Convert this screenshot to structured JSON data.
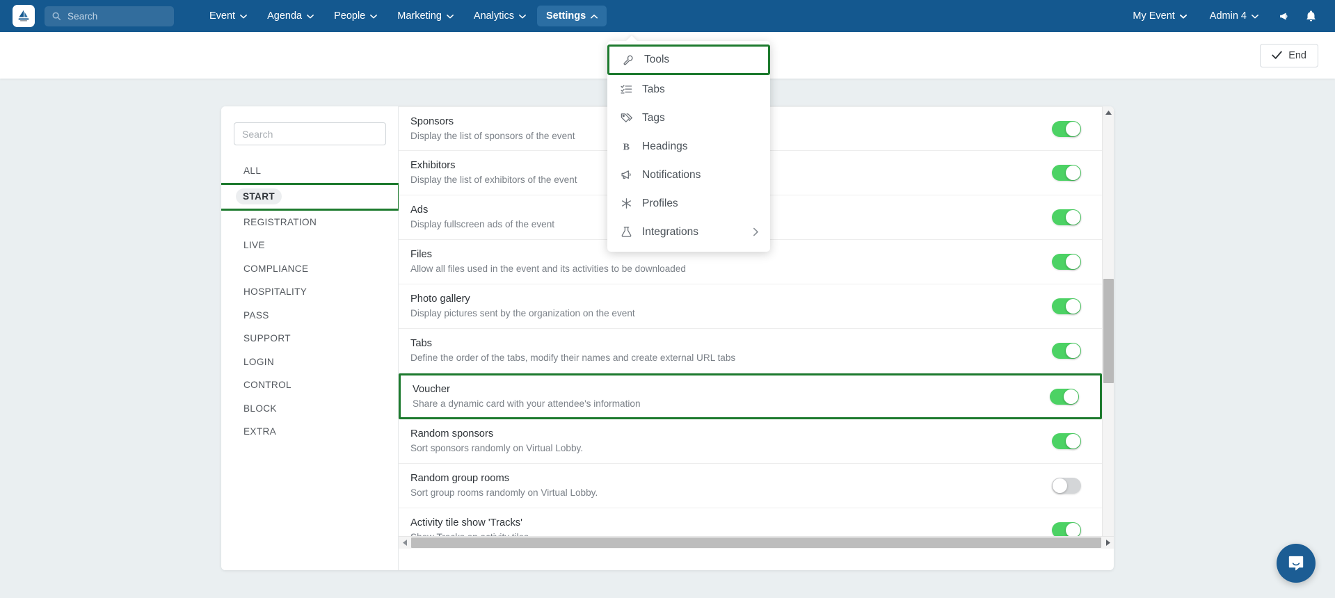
{
  "navbar": {
    "logo_icon": "sailboat-logo-icon",
    "search_placeholder": "Search",
    "search_icon": "search-icon",
    "menus": [
      {
        "label": "Event",
        "icon": "chevron-down-icon"
      },
      {
        "label": "Agenda",
        "icon": "chevron-down-icon"
      },
      {
        "label": "People",
        "icon": "chevron-down-icon"
      },
      {
        "label": "Marketing",
        "icon": "chevron-down-icon"
      },
      {
        "label": "Analytics",
        "icon": "chevron-down-icon"
      },
      {
        "label": "Settings",
        "icon": "chevron-up-icon"
      }
    ],
    "right": {
      "event_label": "My Event",
      "admin_label": "Admin 4",
      "announce_icon": "megaphone-icon",
      "bell_icon": "bell-icon"
    }
  },
  "subheader": {
    "end_label": "End",
    "end_icon": "check-icon"
  },
  "dropdown": {
    "items": [
      {
        "label": "Tools",
        "icon": "wrench-icon",
        "highlighted": true,
        "submenu": false
      },
      {
        "label": "Tabs",
        "icon": "list-checks-icon",
        "highlighted": false,
        "submenu": false
      },
      {
        "label": "Tags",
        "icon": "tags-icon",
        "highlighted": false,
        "submenu": false
      },
      {
        "label": "Headings",
        "icon": "bold-b-icon",
        "highlighted": false,
        "submenu": false
      },
      {
        "label": "Notifications",
        "icon": "megaphone-icon",
        "highlighted": false,
        "submenu": false
      },
      {
        "label": "Profiles",
        "icon": "asterisk-icon",
        "highlighted": false,
        "submenu": false
      },
      {
        "label": "Integrations",
        "icon": "flask-icon",
        "highlighted": false,
        "submenu": true
      }
    ]
  },
  "sidebar": {
    "search_placeholder": "Search",
    "search_value": "",
    "items": [
      {
        "label": "ALL",
        "selected": false,
        "highlighted": false
      },
      {
        "label": "START",
        "selected": true,
        "highlighted": true
      },
      {
        "label": "REGISTRATION",
        "selected": false,
        "highlighted": false
      },
      {
        "label": "LIVE",
        "selected": false,
        "highlighted": false
      },
      {
        "label": "COMPLIANCE",
        "selected": false,
        "highlighted": false
      },
      {
        "label": "HOSPITALITY",
        "selected": false,
        "highlighted": false
      },
      {
        "label": "PASS",
        "selected": false,
        "highlighted": false
      },
      {
        "label": "SUPPORT",
        "selected": false,
        "highlighted": false
      },
      {
        "label": "LOGIN",
        "selected": false,
        "highlighted": false
      },
      {
        "label": "CONTROL",
        "selected": false,
        "highlighted": false
      },
      {
        "label": "BLOCK",
        "selected": false,
        "highlighted": false
      },
      {
        "label": "EXTRA",
        "selected": false,
        "highlighted": false
      }
    ]
  },
  "settings_rows": [
    {
      "title": "Sponsors",
      "description": "Display the list of sponsors of the event",
      "toggle": "on",
      "highlighted": false
    },
    {
      "title": "Exhibitors",
      "description": "Display the list of exhibitors of the event",
      "toggle": "on",
      "highlighted": false
    },
    {
      "title": "Ads",
      "description": "Display fullscreen ads of the event",
      "toggle": "on",
      "highlighted": false
    },
    {
      "title": "Files",
      "description": "Allow all files used in the event and its activities to be downloaded",
      "toggle": "on",
      "highlighted": false
    },
    {
      "title": "Photo gallery",
      "description": "Display pictures sent by the organization on the event",
      "toggle": "on",
      "highlighted": false
    },
    {
      "title": "Tabs",
      "description": "Define the order of the tabs, modify their names and create external URL tabs",
      "toggle": "on",
      "highlighted": false
    },
    {
      "title": "Voucher",
      "description": "Share a dynamic card with your attendee's information",
      "toggle": "on",
      "highlighted": true
    },
    {
      "title": "Random sponsors",
      "description": "Sort sponsors randomly on Virtual Lobby.",
      "toggle": "on",
      "highlighted": false
    },
    {
      "title": "Random group rooms",
      "description": "Sort group rooms randomly on Virtual Lobby.",
      "toggle": "off",
      "highlighted": false
    },
    {
      "title": "Activity tile show 'Tracks'",
      "description": "Show Tracks on activity tiles.",
      "toggle": "on",
      "highlighted": false
    }
  ],
  "scrollbars": {
    "vertical_up_icon": "triangle-up-icon",
    "vertical_down_icon": "triangle-down-icon",
    "horizontal_left_icon": "triangle-left-icon",
    "horizontal_right_icon": "triangle-right-icon"
  },
  "intercom": {
    "icon": "chat-bubble-icon"
  },
  "colors": {
    "navbar_blue": "#14588f",
    "navbar_active_blue": "#2b6ea3",
    "highlight_green": "#1d7a2e",
    "toggle_on_green": "#4cd264",
    "toggle_off_grey": "#d4d6d8",
    "page_background": "#eaeff1",
    "intercom_blue": "#1c5d94"
  }
}
